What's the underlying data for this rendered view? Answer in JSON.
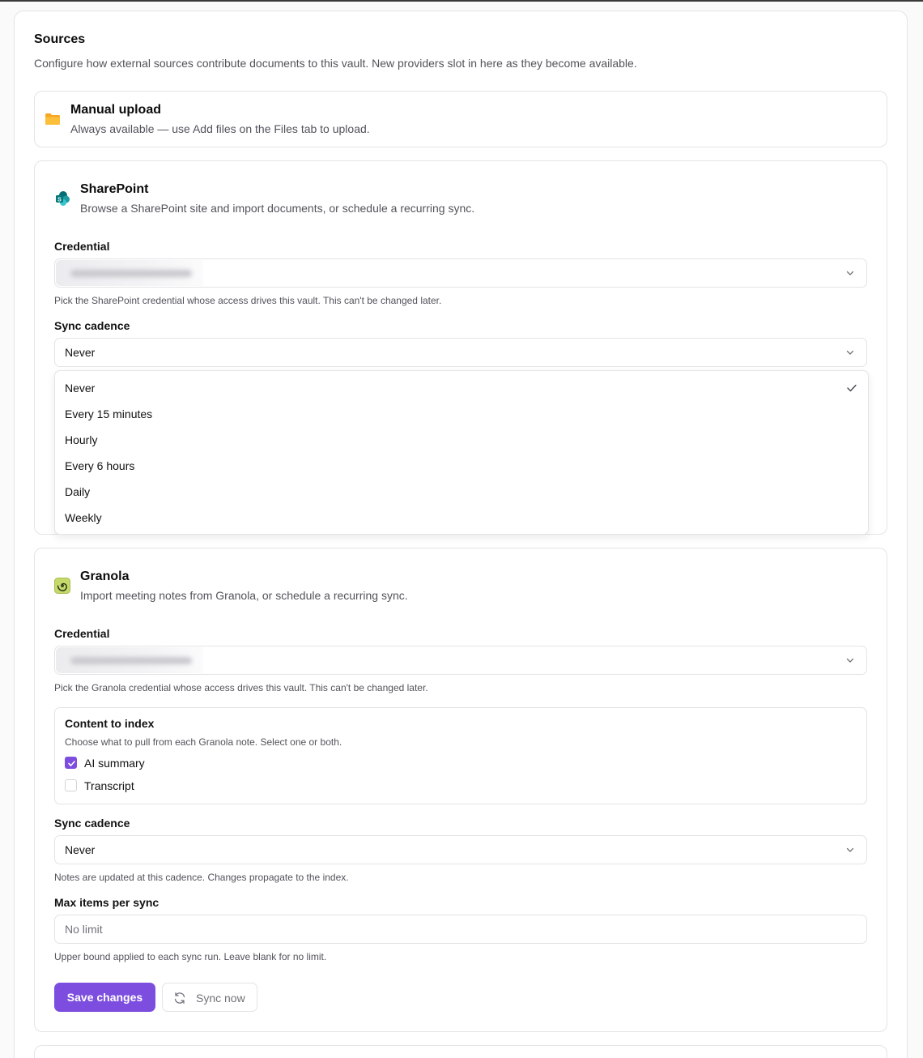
{
  "section": {
    "title": "Sources",
    "description": "Configure how external sources contribute documents to this vault. New providers slot in here as they become available."
  },
  "manual_upload": {
    "icon": "folder-icon",
    "title": "Manual upload",
    "description": "Always available — use Add files on the Files tab to upload."
  },
  "sharepoint": {
    "icon": "sharepoint-icon",
    "title": "SharePoint",
    "description": "Browse a SharePoint site and import documents, or schedule a recurring sync.",
    "credential_label": "Credential",
    "credential_hint": "Pick the SharePoint credential whose access drives this vault. This can't be changed later.",
    "cadence_label": "Sync cadence",
    "cadence_value": "Never",
    "cadence_options": [
      "Never",
      "Every 15 minutes",
      "Hourly",
      "Every 6 hours",
      "Daily",
      "Weekly"
    ],
    "cadence_selected_index": 0
  },
  "granola": {
    "icon": "granola-icon",
    "title": "Granola",
    "description": "Import meeting notes from Granola, or schedule a recurring sync.",
    "credential_label": "Credential",
    "credential_hint": "Pick the Granola credential whose access drives this vault. This can't be changed later.",
    "content": {
      "title": "Content to index",
      "hint": "Choose what to pull from each Granola note. Select one or both.",
      "options": [
        {
          "label": "AI summary",
          "checked": true
        },
        {
          "label": "Transcript",
          "checked": false
        }
      ]
    },
    "cadence_label": "Sync cadence",
    "cadence_value": "Never",
    "cadence_hint": "Notes are updated at this cadence. Changes propagate to the index.",
    "max_items_label": "Max items per sync",
    "max_items_placeholder": "No limit",
    "max_items_hint": "Upper bound applied to each sync run. Leave blank for no limit.",
    "save_label": "Save changes",
    "sync_label": "Sync now"
  },
  "colors": {
    "accent": "#7c4dde",
    "border": "#e4e4e7",
    "muted_text": "#52525b"
  }
}
